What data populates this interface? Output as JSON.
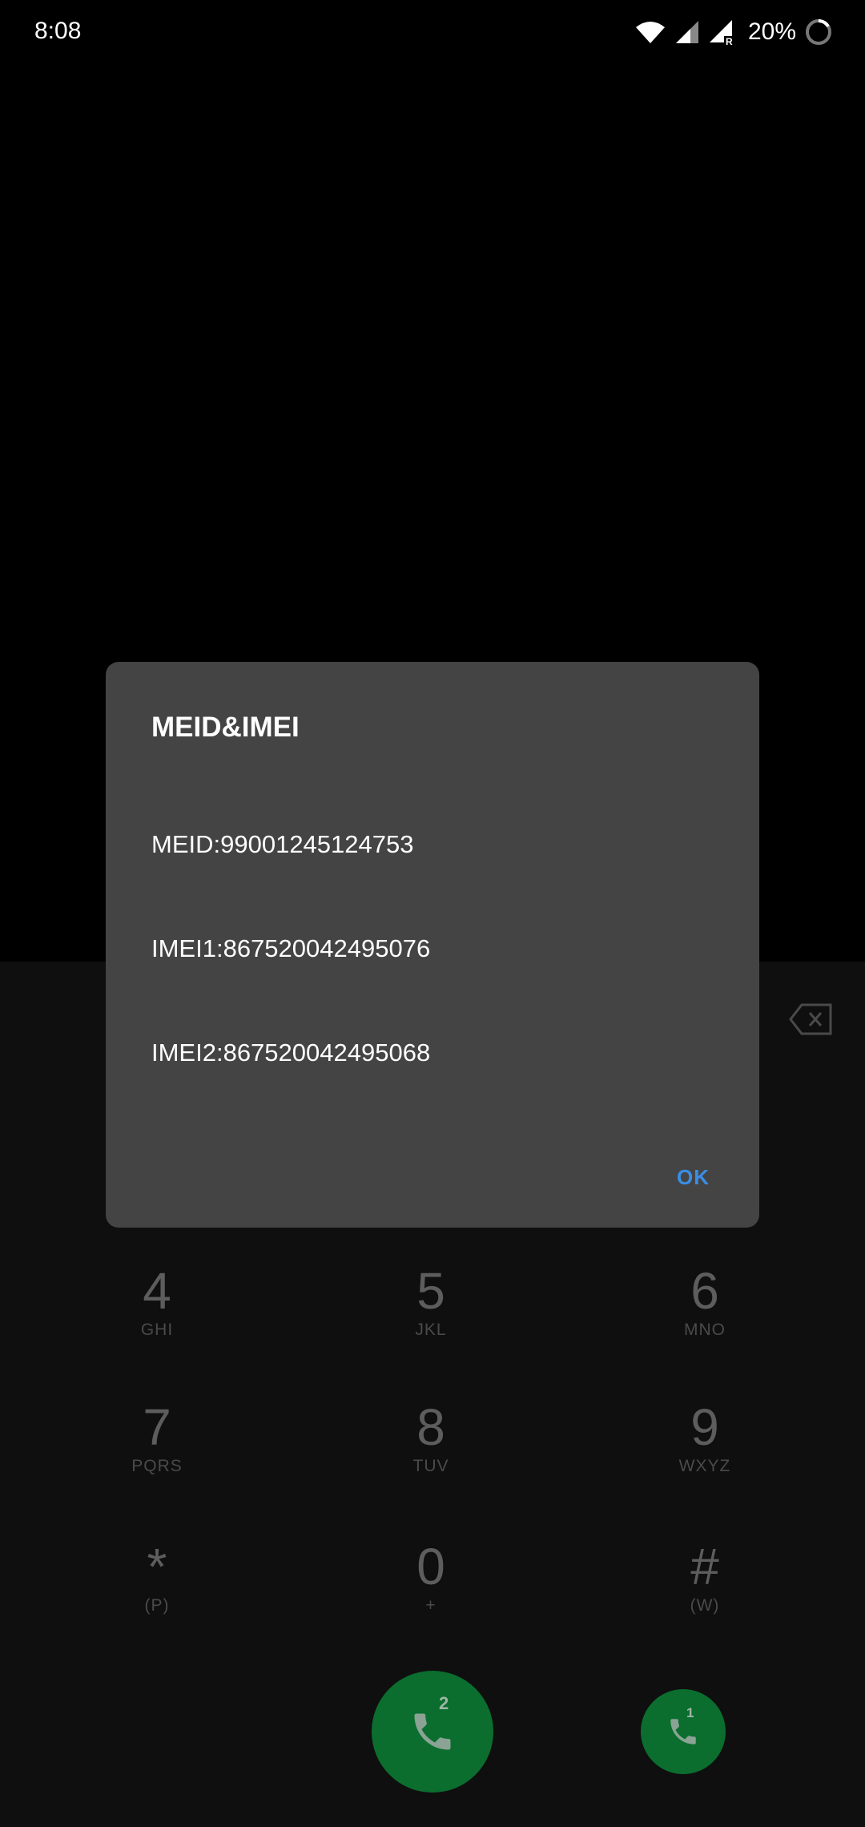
{
  "status_bar": {
    "time": "8:08",
    "battery_percent": "20%",
    "icons": [
      "wifi-icon",
      "signal-icon",
      "signal-roaming-icon",
      "battery-ring-icon"
    ]
  },
  "dialog": {
    "title": "MEID&IMEI",
    "lines": [
      "MEID:99001245124753",
      "IMEI1:867520042495076",
      "IMEI2:867520042495068"
    ],
    "ok_label": "OK"
  },
  "dialpad": {
    "keys": [
      {
        "num": "4",
        "letters": "GHI"
      },
      {
        "num": "5",
        "letters": "JKL"
      },
      {
        "num": "6",
        "letters": "MNO"
      },
      {
        "num": "7",
        "letters": "PQRS"
      },
      {
        "num": "8",
        "letters": "TUV"
      },
      {
        "num": "9",
        "letters": "WXYZ"
      },
      {
        "num": "*",
        "letters": "(P)"
      },
      {
        "num": "0",
        "letters": "+"
      },
      {
        "num": "#",
        "letters": "(W)"
      }
    ],
    "call_sim2_label": "2",
    "call_sim1_label": "1"
  },
  "colors": {
    "dialog_bg": "#444444",
    "accent": "#3a8ee6",
    "call_green": "#0b6e2e"
  }
}
